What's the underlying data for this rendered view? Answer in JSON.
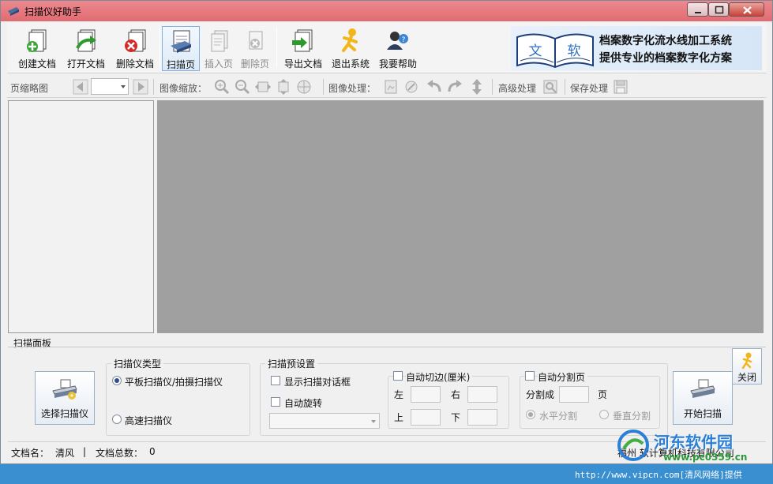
{
  "window": {
    "title": "扫描仪好助手"
  },
  "toolbar": {
    "buttons": [
      {
        "label": "创建文档",
        "icon": "new-doc-icon"
      },
      {
        "label": "打开文档",
        "icon": "open-doc-icon"
      },
      {
        "label": "删除文档",
        "icon": "delete-doc-icon"
      },
      {
        "label": "扫描页",
        "icon": "scan-page-icon"
      },
      {
        "label": "插入页",
        "icon": "insert-page-icon"
      },
      {
        "label": "删除页",
        "icon": "delete-page-icon"
      },
      {
        "label": "导出文档",
        "icon": "export-doc-icon"
      },
      {
        "label": "退出系统",
        "icon": "exit-icon"
      },
      {
        "label": "我要帮助",
        "icon": "help-icon"
      }
    ]
  },
  "banner": {
    "logo_chars": [
      "文",
      "软"
    ],
    "line1": "档案数字化流水线加工系统",
    "line2": "提供专业的档案数字化方案"
  },
  "subtoolbar": {
    "thumbnails_label": "页缩略图",
    "zoom_label": "图像缩放：",
    "image_process_label": "图像处理：",
    "advanced_label": "高级处理",
    "save_label": "保存处理",
    "page_select_value": ""
  },
  "scan_panel": {
    "title": "扫描面板",
    "select_scanner_label": "选择扫描仪",
    "start_scan_label": "开始扫描",
    "close_label": "关闭",
    "scanner_type": {
      "title": "扫描仪类型",
      "options": [
        "平板扫描仪/拍摄扫描仪",
        "高速扫描仪"
      ],
      "selected": 0
    },
    "presets": {
      "title": "扫描预设置",
      "show_dialog_label": "显示扫描对话框",
      "auto_rotate_label": "自动旋转",
      "rotate_value": ""
    },
    "auto_crop": {
      "title": "自动切边(厘米)",
      "left_label": "左",
      "right_label": "右",
      "top_label": "上",
      "bottom_label": "下",
      "left": "",
      "right": "",
      "top": "",
      "bottom": ""
    },
    "auto_split": {
      "title": "自动分割页",
      "split_into_label": "分割成",
      "pages_unit": "页",
      "pages_value": "",
      "horizontal_label": "水平分割",
      "vertical_label": "垂直分割"
    }
  },
  "status": {
    "doc_name_label": "文档名：",
    "doc_name": "清风",
    "separator": "|",
    "doc_total_label": "文档总数：",
    "doc_total": "0",
    "company": "福州 软计算机科技有限公司"
  },
  "watermark": {
    "brand": "河东软件园",
    "site": "www.pc0359.cn",
    "url": "http://www.vipcn.com[清风网络]提供"
  },
  "colors": {
    "titlebar": "#e06b72",
    "viewer_bg": "#a0a0a0",
    "taskbar": "#3a8fd0",
    "banner_accent": "#2e6fc4"
  }
}
